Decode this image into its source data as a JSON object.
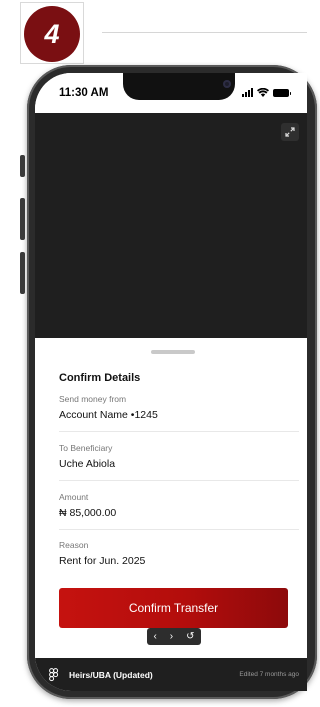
{
  "step": {
    "number": "4"
  },
  "status_bar": {
    "time": "11:30 AM"
  },
  "sheet": {
    "title": "Confirm Details",
    "fields": [
      {
        "label": "Send money from",
        "value": "Account Name •1245"
      },
      {
        "label": "To Beneficiary",
        "value": "Uche Abiola"
      },
      {
        "label": "Amount",
        "value": "₦ 85,000.00"
      },
      {
        "label": "Reason",
        "value": "Rent for Jun. 2025"
      }
    ],
    "confirm_label": "Confirm Transfer"
  },
  "prototype_nav": {
    "back": "‹",
    "forward": "›",
    "restart": "↺"
  },
  "figma_bar": {
    "file_name": "Heirs/UBA (Updated)",
    "edited": "Edited 7 months ago"
  },
  "colors": {
    "brand_dark": "#7a0f12",
    "button_start": "#c5120f",
    "button_end": "#8d0a0b",
    "video_bg": "#1f1f1f"
  },
  "icons": [
    "expand-icon",
    "signal-icon",
    "wifi-icon",
    "battery-icon",
    "figma-logo-icon"
  ]
}
